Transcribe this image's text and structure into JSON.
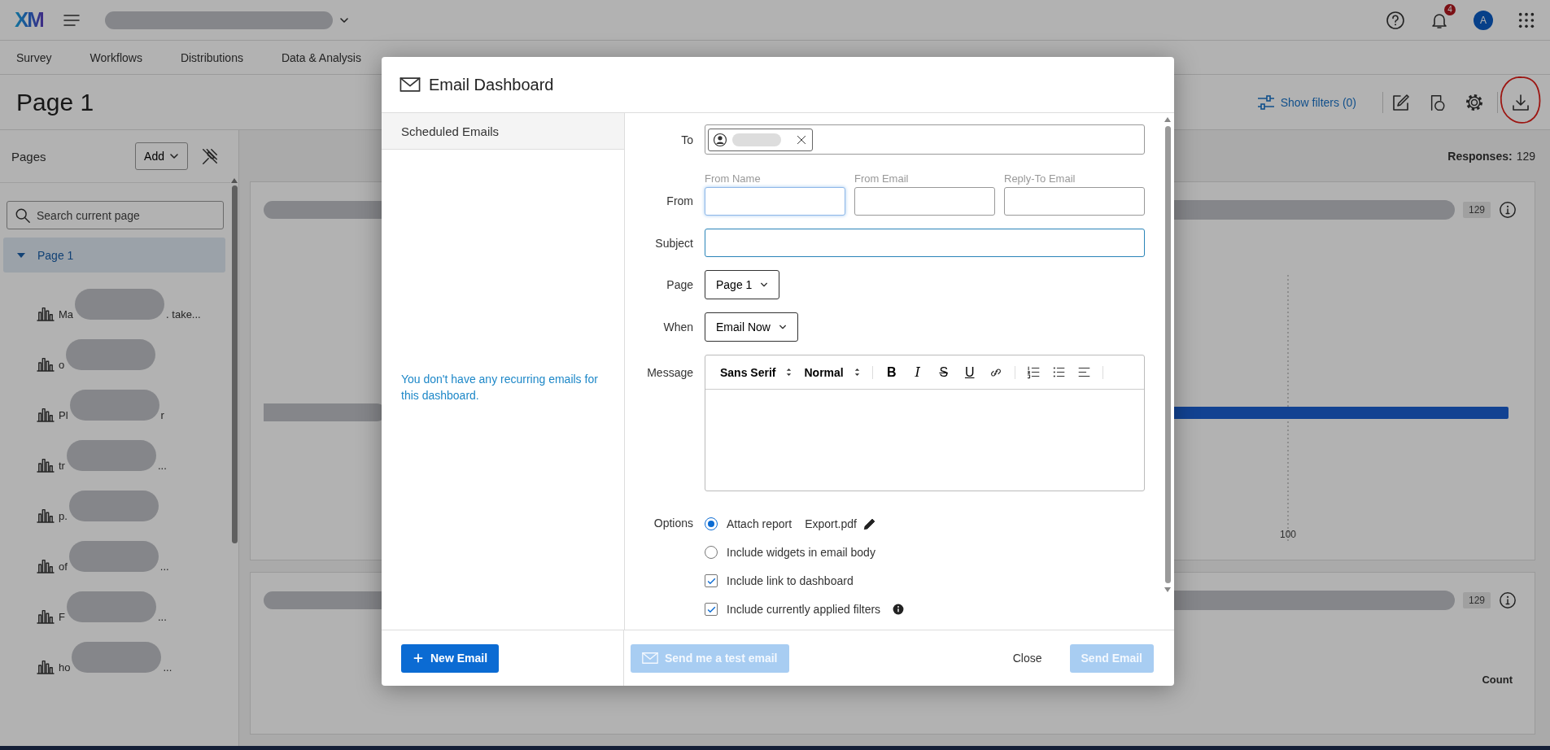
{
  "top_bar": {
    "logo": "XM",
    "notification_count": "4",
    "avatar_initial": "A"
  },
  "nav_tabs": [
    {
      "label": "Survey"
    },
    {
      "label": "Workflows"
    },
    {
      "label": "Distributions"
    },
    {
      "label": "Data & Analysis"
    }
  ],
  "page_header": {
    "title": "Page 1",
    "show_filters": "Show filters (0)"
  },
  "sidebar": {
    "title": "Pages",
    "add_button": "Add",
    "search_placeholder": "Search current page",
    "pages": [
      {
        "label": "Page 1",
        "selected": true,
        "expanded": true,
        "children": [
          {
            "head": "Ma",
            "tail": ". take..."
          },
          {
            "head": "o"
          },
          {
            "head": "Pl",
            "tail": "r"
          },
          {
            "head": "tr",
            "tail": "..."
          },
          {
            "head": "p."
          },
          {
            "head": "of",
            "tail": "..."
          },
          {
            "head": "F",
            "tail": "..."
          },
          {
            "head": "ho",
            "tail": "..."
          }
        ]
      }
    ]
  },
  "main": {
    "responses_label": "Responses:",
    "responses_value": "129",
    "widgets": [
      {
        "kind": "bar_chart",
        "count": "129",
        "tick_label": "100"
      },
      {
        "kind": "table",
        "count": "129",
        "column_label": "Count"
      }
    ]
  },
  "dialog": {
    "title": "Email Dashboard",
    "scheduled_heading": "Scheduled Emails",
    "empty_message": "You don't have any recurring emails for this dashboard.",
    "new_email_button": "New Email",
    "to": {
      "label": "To"
    },
    "from": {
      "label": "From",
      "fields": [
        {
          "label": "From Name",
          "focused": true
        },
        {
          "label": "From Email",
          "focused": false
        },
        {
          "label": "Reply-To Email",
          "focused": false
        }
      ]
    },
    "subject": {
      "label": "Subject",
      "focused": true
    },
    "page": {
      "label": "Page",
      "value": "Page 1"
    },
    "when": {
      "label": "When",
      "value": "Email Now"
    },
    "message": {
      "label": "Message",
      "font": "Sans Serif",
      "size": "Normal",
      "format_buttons": [
        {
          "label": "B",
          "kind": "bold"
        },
        {
          "label": "I",
          "kind": "italic"
        },
        {
          "label": "S",
          "kind": "strike"
        },
        {
          "label": "U",
          "kind": "underline"
        }
      ]
    },
    "options": {
      "label": "Options",
      "items": [
        {
          "kind": "radio",
          "label": "Attach report",
          "selected": true,
          "file": "Export.pdf"
        },
        {
          "kind": "radio",
          "label": "Include widgets in email body",
          "selected": false
        },
        {
          "kind": "checkbox",
          "label": "Include link to dashboard",
          "checked": true
        },
        {
          "kind": "checkbox",
          "label": "Include currently applied filters",
          "checked": true,
          "info": true
        }
      ]
    },
    "footer_buttons": [
      {
        "label": "Send me a test email",
        "kind": "test",
        "disabled": true
      },
      {
        "label": "Close",
        "kind": "plain",
        "disabled": false
      },
      {
        "label": "Send Email",
        "kind": "primary",
        "disabled": true
      }
    ]
  }
}
